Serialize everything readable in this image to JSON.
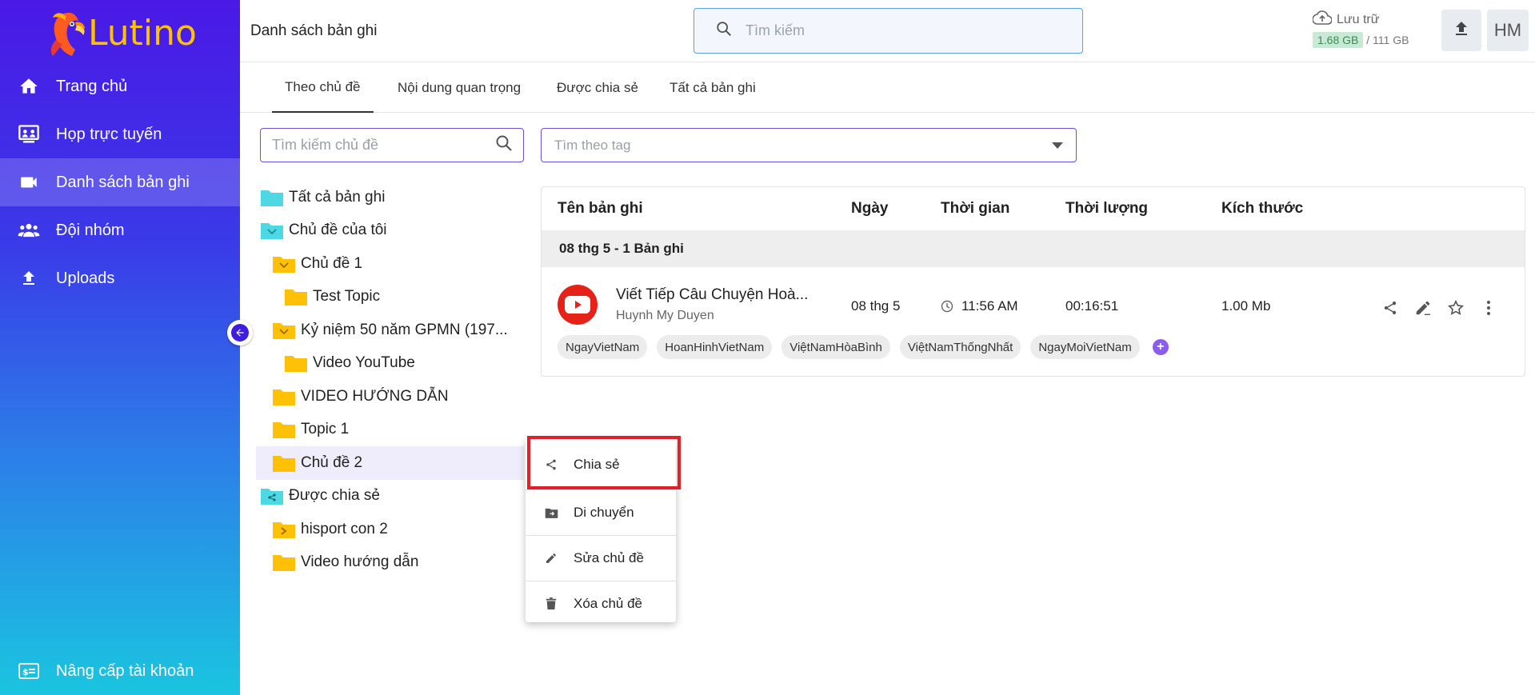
{
  "app": {
    "brand": "Lutino",
    "accent": "#4a19e6",
    "brand_color": "#ffc107"
  },
  "sidebar": {
    "items": [
      {
        "label": "Trang chủ",
        "icon": "home-icon",
        "active": false
      },
      {
        "label": "Họp trực tuyến",
        "icon": "meeting-icon",
        "active": false
      },
      {
        "label": "Danh sách bản ghi",
        "icon": "video-camera-icon",
        "active": true
      },
      {
        "label": "Đội nhóm",
        "icon": "team-icon",
        "active": false
      },
      {
        "label": "Uploads",
        "icon": "upload-icon",
        "active": false
      }
    ],
    "bottom": {
      "label": "Nâng cấp tài khoản",
      "icon": "upgrade-card-icon"
    }
  },
  "header": {
    "title": "Danh sách bản ghi",
    "search_placeholder": "Tìm kiếm",
    "storage_label": "Lưu trữ",
    "storage_used": "1.68 GB",
    "storage_total": "/ 111 GB",
    "avatar_initials": "HM"
  },
  "tabs": [
    {
      "label": "Theo chủ đề",
      "active": true
    },
    {
      "label": "Nội dung quan trọng",
      "active": false
    },
    {
      "label": "Được chia sẻ",
      "active": false
    },
    {
      "label": "Tất cả bản ghi",
      "active": false
    }
  ],
  "filters": {
    "topic_search_placeholder": "Tìm kiếm chủ đề",
    "tag_placeholder": "Tìm theo tag"
  },
  "tree": [
    {
      "label": "Tất cả bản ghi",
      "level": 0,
      "type": "cyan"
    },
    {
      "label": "Chủ đề của tôi",
      "level": 0,
      "type": "cyan-expanded"
    },
    {
      "label": "Chủ đề 1",
      "level": 1,
      "type": "yellow-expanded"
    },
    {
      "label": "Test Topic",
      "level": 2,
      "type": "yellow"
    },
    {
      "label": "Kỷ niệm 50 năm GPMN (197...",
      "level": 1,
      "type": "yellow-expanded"
    },
    {
      "label": "Video YouTube",
      "level": 2,
      "type": "yellow"
    },
    {
      "label": "VIDEO HƯỚNG DẪN",
      "level": 1,
      "type": "yellow"
    },
    {
      "label": "Topic 1",
      "level": 1,
      "type": "yellow"
    },
    {
      "label": "Chủ đề 2",
      "level": 1,
      "type": "yellow",
      "selected": true
    },
    {
      "label": "Được chia sẻ",
      "level": 0,
      "type": "cyan-shared"
    },
    {
      "label": "hisport con 2",
      "level": 1,
      "type": "yellow-collapsed"
    },
    {
      "label": "Video hướng dẫn",
      "level": 1,
      "type": "yellow"
    }
  ],
  "table": {
    "columns": [
      "Tên bản ghi",
      "Ngày",
      "Thời gian",
      "Thời lượng",
      "Kích thước"
    ],
    "group_label": "08 thg 5 - 1 Bản ghi",
    "record": {
      "title": "Viết Tiếp Câu Chuyện Hoà...",
      "owner": "Huynh My Duyen",
      "date": "08 thg 5",
      "time": "11:56 AM",
      "duration": "00:16:51",
      "size": "1.00 Mb",
      "tags": [
        "NgayVietNam",
        "HoanHinhVietNam",
        "ViệtNamHòaBình",
        "ViệtNamThốngNhất",
        "NgayMoiVietNam"
      ]
    }
  },
  "context_menu": {
    "items": [
      {
        "label": "Chia sẻ",
        "icon": "share-icon"
      },
      {
        "label": "Di chuyển",
        "icon": "move-folder-icon"
      },
      {
        "label": "Sửa chủ đề",
        "icon": "pencil-icon"
      },
      {
        "label": "Xóa chủ đề",
        "icon": "trash-icon"
      }
    ],
    "highlight_color": "#e0202a"
  }
}
